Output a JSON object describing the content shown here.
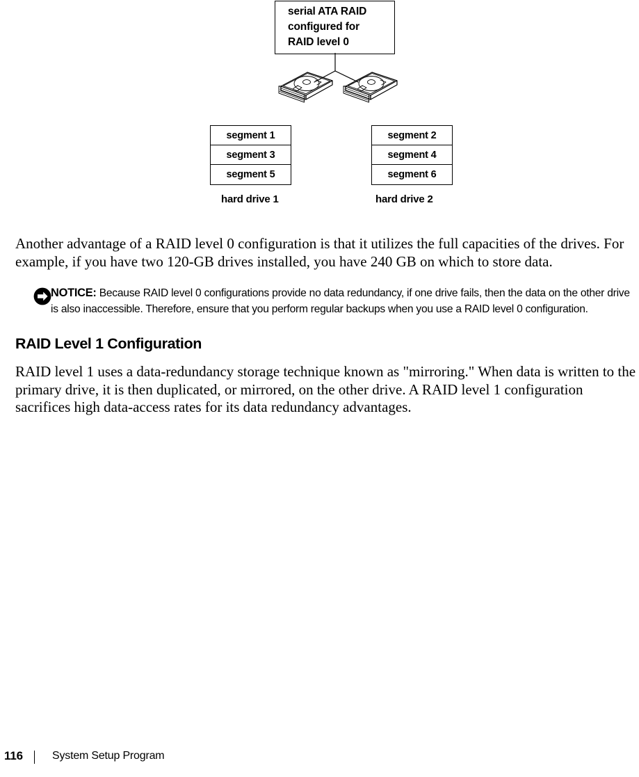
{
  "figure": {
    "callout": {
      "lines": [
        "serial ATA RAID",
        "configured for",
        "RAID level 0"
      ],
      "text": "serial ATA RAID configured for RAID level 0"
    },
    "drives": [
      {
        "label": "hard drive 1",
        "segments": [
          "segment 1",
          "segment 3",
          "segment 5"
        ]
      },
      {
        "label": "hard drive 2",
        "segments": [
          "segment 2",
          "segment 4",
          "segment 6"
        ]
      }
    ]
  },
  "content": {
    "paragraph_1": "Another advantage of a RAID level 0 configuration is that it utilizes the full capacities of the drives. For example, if you have two 120-GB drives installed, you have 240 GB on which to store data.",
    "notice": {
      "icon": "notice-arrow-icon",
      "label": "NOTICE:",
      "text": "Because RAID level 0 configurations provide no data redundancy, if one drive fails, then the data on the other drive is also inaccessible. Therefore, ensure that you perform regular backups when you use a RAID level 0 configuration."
    },
    "heading": "RAID Level 1 Configuration",
    "paragraph_2": "RAID level 1 uses a data-redundancy storage technique known as \"mirroring.\" When data is written to the primary drive, it is then duplicated, or mirrored, on the other drive. A RAID level 1 configuration sacrifices high data-access rates for its data redundancy advantages."
  },
  "footer": {
    "page_number": "116",
    "divider": "|",
    "title": "System Setup Program"
  },
  "colors": {
    "text": "#000000",
    "background": "#ffffff",
    "rule": "#000000"
  }
}
